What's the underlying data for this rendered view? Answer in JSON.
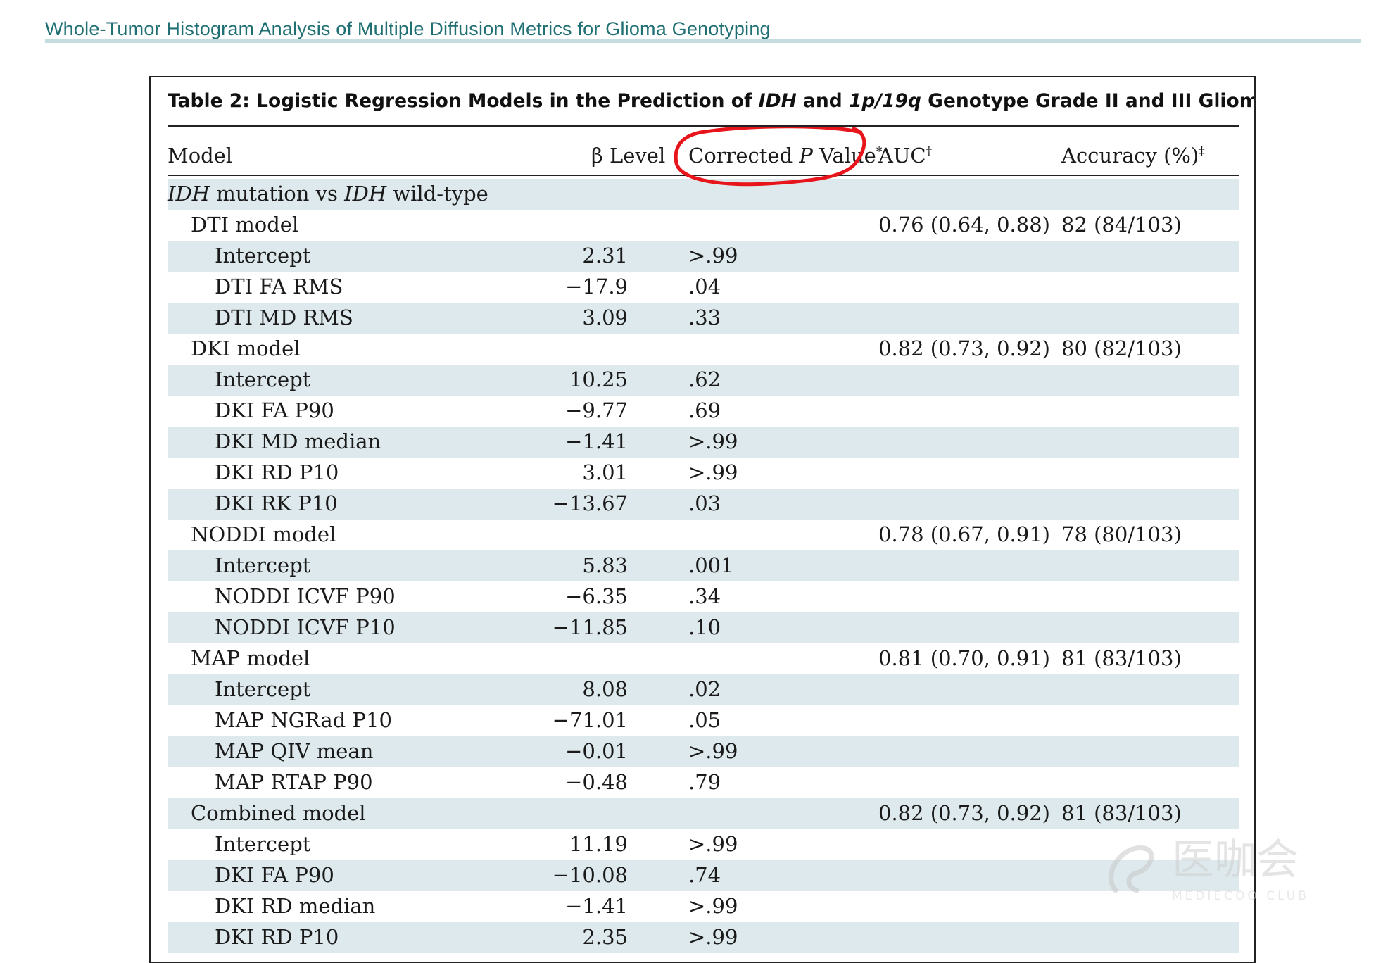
{
  "running_head": "Whole-Tumor Histogram Analysis of Multiple Diffusion Metrics for Glioma Genotyping",
  "table": {
    "title_prefix": "Table 2: Logistic Regression Models in the Prediction of ",
    "title_italic_1": "IDH",
    "title_mid": " and ",
    "title_italic_2": "1p/19q",
    "title_suffix": " Genotype Grade II and III Gliomas",
    "headers": {
      "model": "Model",
      "beta": "β Level",
      "p_prefix": "Corrected ",
      "p_italic": "P",
      "p_suffix": " Value",
      "p_mark": "*",
      "auc": "AUC",
      "auc_mark": "†",
      "acc": "Accuracy (%)",
      "acc_mark": "‡"
    },
    "section": {
      "italic_1": "IDH",
      "mid": " mutation vs ",
      "italic_2": "IDH",
      "suffix": " wild-type"
    },
    "rows": [
      {
        "label": "DTI model",
        "beta": "",
        "p": "",
        "auc": "0.76 (0.64, 0.88)",
        "acc": "82 (84/103)"
      },
      {
        "label": "Intercept",
        "beta": "2.31",
        "p": ">.99",
        "auc": "",
        "acc": ""
      },
      {
        "label": "DTI FA RMS",
        "beta": "−17.9",
        "p": ".04",
        "auc": "",
        "acc": ""
      },
      {
        "label": "DTI MD RMS",
        "beta": "3.09",
        "p": ".33",
        "auc": "",
        "acc": ""
      },
      {
        "label": "DKI model",
        "beta": "",
        "p": "",
        "auc": "0.82 (0.73, 0.92)",
        "acc": "80 (82/103)"
      },
      {
        "label": "Intercept",
        "beta": "10.25",
        "p": ".62",
        "auc": "",
        "acc": ""
      },
      {
        "label": "DKI FA P90",
        "beta": "−9.77",
        "p": ".69",
        "auc": "",
        "acc": ""
      },
      {
        "label": "DKI MD median",
        "beta": "−1.41",
        "p": ">.99",
        "auc": "",
        "acc": ""
      },
      {
        "label": "DKI RD P10",
        "beta": "3.01",
        "p": ">.99",
        "auc": "",
        "acc": ""
      },
      {
        "label": "DKI RK P10",
        "beta": "−13.67",
        "p": ".03",
        "auc": "",
        "acc": ""
      },
      {
        "label": "NODDI model",
        "beta": "",
        "p": "",
        "auc": "0.78 (0.67, 0.91)",
        "acc": "78 (80/103)"
      },
      {
        "label": "Intercept",
        "beta": "5.83",
        "p": ".001",
        "auc": "",
        "acc": ""
      },
      {
        "label": "NODDI ICVF P90",
        "beta": "−6.35",
        "p": ".34",
        "auc": "",
        "acc": ""
      },
      {
        "label": "NODDI ICVF P10",
        "beta": "−11.85",
        "p": ".10",
        "auc": "",
        "acc": ""
      },
      {
        "label": "MAP model",
        "beta": "",
        "p": "",
        "auc": "0.81 (0.70, 0.91)",
        "acc": "81 (83/103)"
      },
      {
        "label": "Intercept",
        "beta": "8.08",
        "p": ".02",
        "auc": "",
        "acc": ""
      },
      {
        "label": "MAP NGRad P10",
        "beta": "−71.01",
        "p": ".05",
        "auc": "",
        "acc": ""
      },
      {
        "label": "MAP QIV mean",
        "beta": "−0.01",
        "p": ">.99",
        "auc": "",
        "acc": ""
      },
      {
        "label": "MAP RTAP P90",
        "beta": "−0.48",
        "p": ".79",
        "auc": "",
        "acc": ""
      },
      {
        "label": "Combined model",
        "beta": "",
        "p": "",
        "auc": "0.82 (0.73, 0.92)",
        "acc": "81 (83/103)"
      },
      {
        "label": "Intercept",
        "beta": "11.19",
        "p": ">.99",
        "auc": "",
        "acc": ""
      },
      {
        "label": "DKI FA P90",
        "beta": "−10.08",
        "p": ".74",
        "auc": "",
        "acc": ""
      },
      {
        "label": "DKI RD median",
        "beta": "−1.41",
        "p": ">.99",
        "auc": "",
        "acc": ""
      },
      {
        "label": "DKI RD P10",
        "beta": "2.35",
        "p": ">.99",
        "auc": "",
        "acc": ""
      }
    ]
  },
  "annotation": {
    "color": "#e8141c"
  },
  "watermark": {
    "text": "医咖会",
    "subtext": "MEDIECOO CLUB"
  }
}
